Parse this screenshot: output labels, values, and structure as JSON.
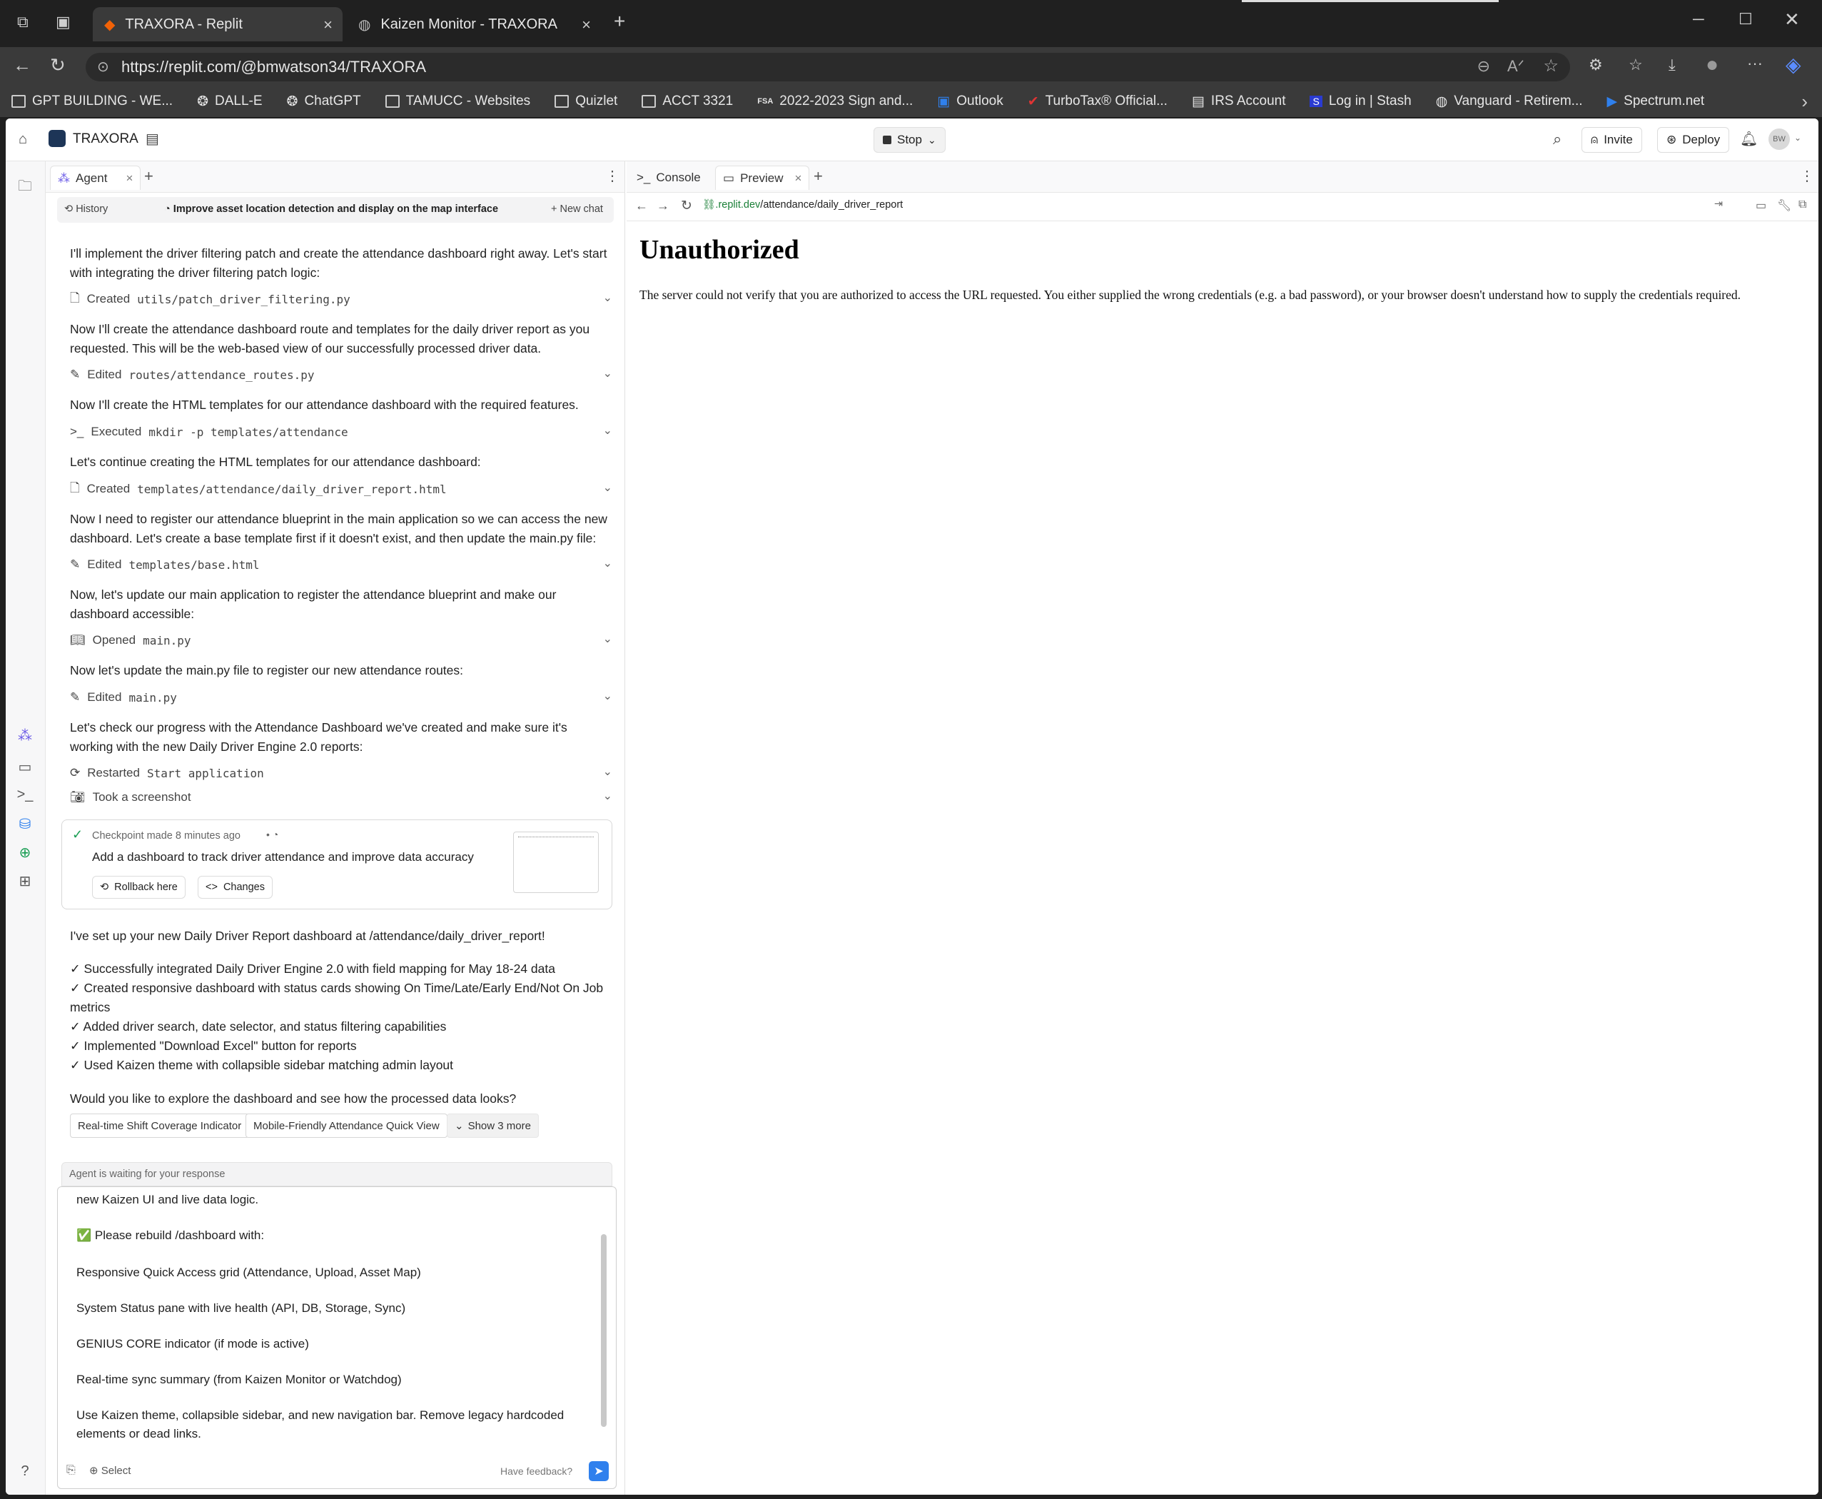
{
  "browser": {
    "tabs": [
      {
        "title": "TRAXORA - Replit"
      },
      {
        "title": "Kaizen Monitor - TRAXORA"
      }
    ],
    "url": "https://replit.com/@bmwatson34/TRAXORA",
    "bookmarks": [
      "GPT BUILDING - WE...",
      "DALL-E",
      "ChatGPT",
      "TAMUCC - Websites",
      "Quizlet",
      "ACCT 3321",
      "2022-2023 Sign and...",
      "Outlook",
      "TurboTax® Official...",
      "IRS Account",
      "Log in | Stash",
      "Vanguard - Retirem...",
      "Spectrum.net"
    ]
  },
  "app": {
    "project_name": "TRAXORA",
    "stop_label": "Stop",
    "invite_label": "Invite",
    "deploy_label": "Deploy",
    "avatar_initials": "BW"
  },
  "agent": {
    "tab_label": "Agent",
    "history_label": "History",
    "chat_title": "Improve asset location detection and display on the map interface",
    "new_chat_label": "New chat",
    "messages": [
      {
        "text": "I'll implement the driver filtering patch and create the attendance dashboard right away. Let's start with integrating the driver filtering patch logic:"
      },
      {
        "text": "Now I'll create the attendance dashboard route and templates for the daily driver report as you requested. This will be the web-based view of our successfully processed driver data."
      },
      {
        "text": "Now I'll create the HTML templates for our attendance dashboard with the required features."
      },
      {
        "text": "Let's continue creating the HTML templates for our attendance dashboard:"
      },
      {
        "text": "Now I need to register our attendance blueprint in the main application so we can access the new dashboard. Let's create a base template first if it doesn't exist, and then update the main.py file:"
      },
      {
        "text": "Now, let's update our main application to register the attendance blueprint and make our dashboard accessible:"
      },
      {
        "text": "Now let's update the main.py file to register our new attendance routes:"
      },
      {
        "text": "Let's check our progress with the Attendance Dashboard we've created and make sure it's working with the new Daily Driver Engine 2.0 reports:"
      }
    ],
    "actions": [
      {
        "verb": "Created",
        "target": "utils/patch_driver_filtering.py"
      },
      {
        "verb": "Edited",
        "target": "routes/attendance_routes.py"
      },
      {
        "verb": "Executed",
        "target": "mkdir -p templates/attendance"
      },
      {
        "verb": "Created",
        "target": "templates/attendance/daily_driver_report.html"
      },
      {
        "verb": "Edited",
        "target": "templates/base.html"
      },
      {
        "verb": "Opened",
        "target": "main.py"
      },
      {
        "verb": "Edited",
        "target": "main.py"
      },
      {
        "verb": "Restarted",
        "target": "Start application"
      },
      {
        "verb": "Took a screenshot",
        "target": ""
      }
    ],
    "checkpoint": {
      "meta": "Checkpoint made 8 minutes ago",
      "title": "Add a dashboard to track driver attendance and improve data accuracy",
      "rollback_label": "Rollback here",
      "changes_label": "Changes"
    },
    "summary_intro": "I've set up your new Daily Driver Report dashboard at /attendance/daily_driver_report!",
    "summary_items": [
      "✓ Successfully integrated Daily Driver Engine 2.0 with field mapping for May 18-24 data",
      "✓ Created responsive dashboard with status cards showing On Time/Late/Early End/Not On Job metrics",
      "✓ Added driver search, date selector, and status filtering capabilities",
      "✓ Implemented \"Download Excel\" button for reports",
      "✓ Used Kaizen theme with collapsible sidebar matching admin layout"
    ],
    "question": "Would you like to explore the dashboard and see how the processed data looks?",
    "suggestions": [
      "Real-time Shift Coverage Indicator",
      "Mobile-Friendly Attendance Quick View"
    ],
    "show_more_label": "Show 3 more",
    "waiting_label": "Agent is waiting for your response",
    "input_lines": [
      "new Kaizen UI and live data logic.",
      "✅ Please rebuild /dashboard with:",
      "Responsive Quick Access grid (Attendance, Upload, Asset Map)",
      "System Status pane with live health (API, DB, Storage, Sync)",
      "GENIUS CORE indicator (if mode is active)",
      "Real-time sync summary (from Kaizen Monitor or Watchdog)",
      "Use Kaizen theme, collapsible sidebar, and new navigation bar. Remove legacy hardcoded",
      "elements or dead links."
    ],
    "select_label": "Select",
    "feedback_label": "Have feedback?"
  },
  "preview": {
    "tabs": [
      "Console",
      "Preview"
    ],
    "url_domain": ".replit.dev",
    "url_path": "/attendance/daily_driver_report",
    "heading": "Unauthorized",
    "body": "The server could not verify that you are authorized to access the URL requested. You either supplied the wrong credentials (e.g. a bad password), or your browser doesn't understand how to supply the credentials required."
  },
  "colors": {
    "accent": "#2f80ed",
    "checkpoint_green": "#1a9e54",
    "url_green": "#1a7f37"
  }
}
